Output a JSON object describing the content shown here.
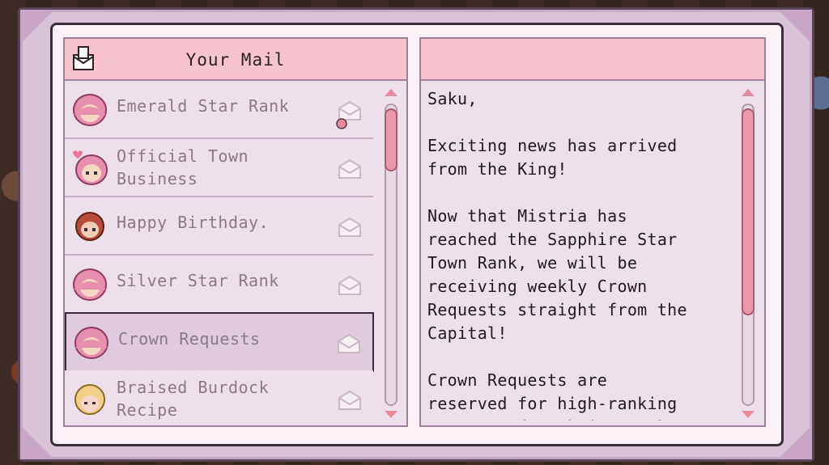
{
  "mailbox": {
    "title": "Your Mail",
    "items": [
      {
        "label": "Emerald Star Rank",
        "avatar": "pink-hair-girl",
        "icon": "envelope-icon",
        "extra": "attachment-icon"
      },
      {
        "label": "Official Town\nBusiness",
        "avatar": "pink-hair-girl-heart",
        "icon": "envelope-icon"
      },
      {
        "label": "Happy Birthday.",
        "avatar": "red-hair-boy",
        "icon": "envelope-icon"
      },
      {
        "label": "Silver Star Rank",
        "avatar": "pink-hair-girl",
        "icon": "envelope-icon"
      },
      {
        "label": "Crown Requests",
        "avatar": "pink-hair-girl",
        "icon": "envelope-icon",
        "selected": true
      },
      {
        "label": "Braised Burdock\nRecipe",
        "avatar": "blonde-chef",
        "icon": "envelope-icon"
      }
    ]
  },
  "letter": {
    "header": "",
    "body": "Saku,\n\nExciting news has arrived\nfrom the King!\n\nNow that Mistria has\nreached the Sapphire Star\nTown Rank, we will be\nreceiving weekly Crown\nRequests straight from the\nCapital!\n\nCrown Requests are\nreserved for high-ranking\ntowns, and each is worth a"
  },
  "colors": {
    "accent": "#f7c3cf",
    "thumb": "#e89aaa",
    "panel": "#eee0ea"
  }
}
